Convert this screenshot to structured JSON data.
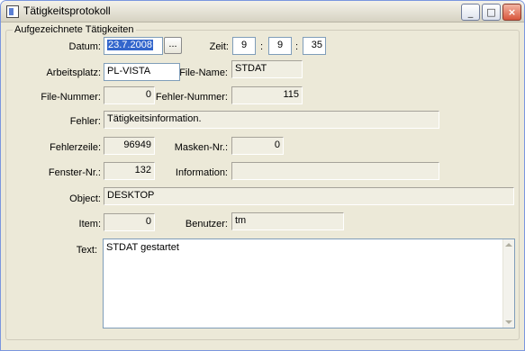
{
  "window": {
    "title": "Tätigkeitsprotokoll",
    "minimize_icon": "minimize-icon",
    "maximize_icon": "maximize-icon",
    "close_icon": "close-icon"
  },
  "group": {
    "legend": "Aufgezeichnete Tätigkeiten"
  },
  "labels": {
    "datum": "Datum:",
    "zeit": "Zeit:",
    "arbeitsplatz": "Arbeitsplatz:",
    "file_name": "File-Name:",
    "file_nummer": "File-Nummer:",
    "fehler_nummer": "Fehler-Nummer:",
    "fehler": "Fehler:",
    "fehlerzeile": "Fehlerzeile:",
    "masken_nr": "Masken-Nr.:",
    "fenster_nr": "Fenster-Nr.:",
    "information": "Information:",
    "object": "Object:",
    "item": "Item:",
    "benutzer": "Benutzer:",
    "text": "Text:"
  },
  "values": {
    "datum": "23.7.2008",
    "datum_button": "...",
    "zeit_h": "9",
    "zeit_m": "9",
    "zeit_s": "35",
    "colon": ":",
    "arbeitsplatz": "PL-VISTA",
    "file_name": "STDAT",
    "file_nummer": "0",
    "fehler_nummer": "115",
    "fehler": "Tätigkeitsinformation.",
    "fehlerzeile": "96949",
    "masken_nr": "0",
    "fenster_nr": "132",
    "information": "",
    "object": "DESKTOP",
    "item": "0",
    "benutzer": "tm",
    "text": "STDAT gestartet"
  },
  "colors": {
    "title_bar": "#ECE9D8",
    "date_highlight": "#FFFF00",
    "selection": "#3366CC"
  }
}
